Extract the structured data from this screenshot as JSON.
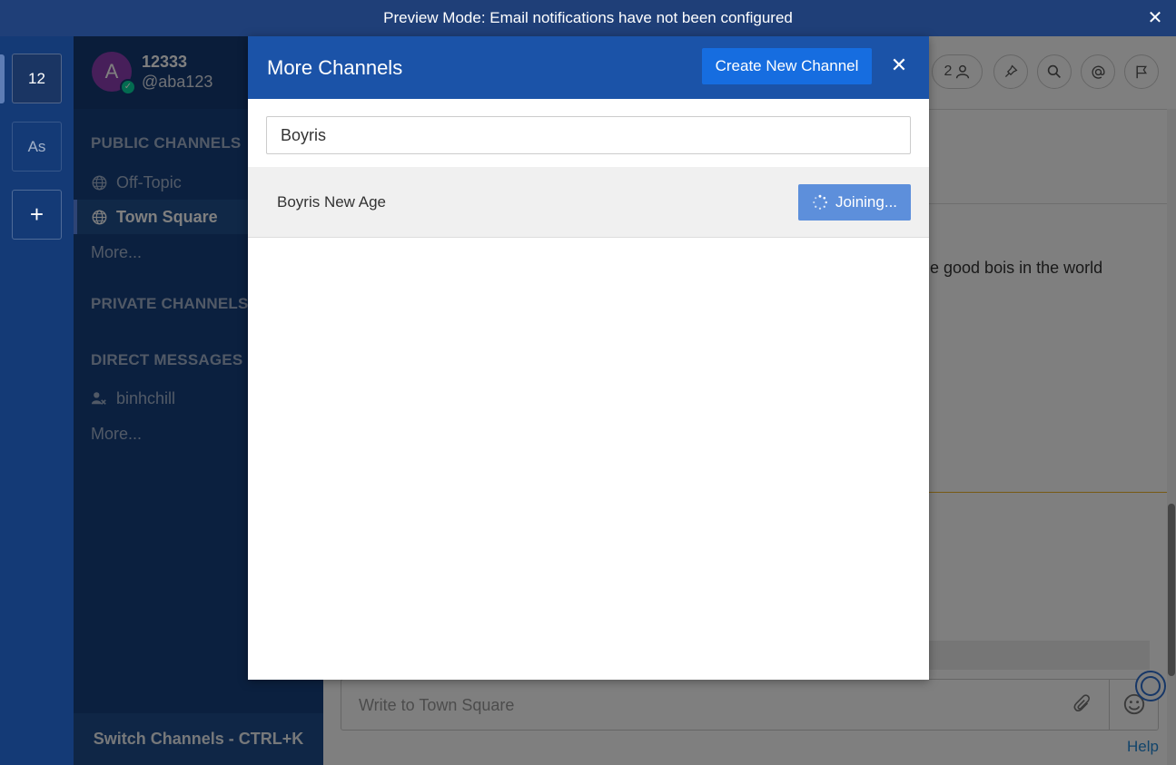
{
  "banner": {
    "text": "Preview Mode: Email notifications have not been configured",
    "close_icon": "✕"
  },
  "teams": [
    {
      "label": "12",
      "active": true
    },
    {
      "label": "As",
      "active": false
    },
    {
      "label": "+",
      "active": false
    }
  ],
  "user": {
    "avatar_letter": "A",
    "name": "12333",
    "handle": "@aba123",
    "status_icon": "✓"
  },
  "sidebar": {
    "public_title": "PUBLIC CHANNELS",
    "public_channels": [
      {
        "label": "Off-Topic",
        "active": false
      },
      {
        "label": "Town Square",
        "active": true
      }
    ],
    "public_more": "More...",
    "private_title": "PRIVATE CHANNELS",
    "dm_title": "DIRECT MESSAGES",
    "direct_messages": [
      {
        "label": "binhchill"
      }
    ],
    "dm_more": "More...",
    "switch_label": "Switch Channels - CTRL+K"
  },
  "main": {
    "member_count": "2",
    "message_fragment": "e good bois in the world",
    "composer_placeholder": "Write to Town Square",
    "help_label": "Help"
  },
  "modal": {
    "title": "More Channels",
    "create_label": "Create New Channel",
    "close_icon": "✕",
    "search_value": "Boyris",
    "results": [
      {
        "name": "Boyris New Age",
        "button_label": "Joining..."
      }
    ]
  },
  "colors": {
    "banner": "#1f3f78",
    "sidebar": "#16417f",
    "modal_header": "#1b53a8",
    "create_button": "#166de0",
    "join_button": "#5d8fdb"
  }
}
